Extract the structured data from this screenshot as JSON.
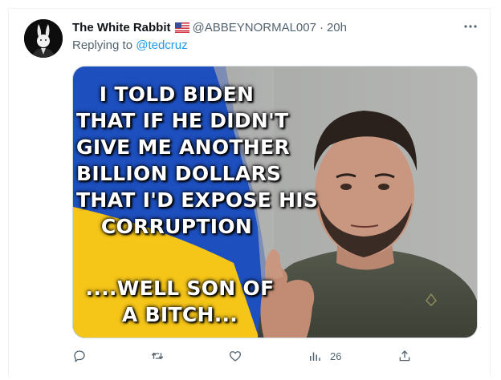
{
  "tweet": {
    "display_name": "The White Rabbit",
    "flag_icon": "us-flag-icon",
    "handle": "@ABBEYNORMAL007",
    "separator": "·",
    "time": "20h",
    "replying_prefix": "Replying to",
    "replying_to": "@tedcruz",
    "more_icon": "more-horizontal-icon"
  },
  "meme": {
    "top_lines": [
      "I TOLD BIDEN",
      "THAT IF HE DIDN'T",
      "GIVE ME ANOTHER",
      "BILLION DOLLARS",
      "THAT I'D EXPOSE HIS",
      "CORRUPTION"
    ],
    "bottom_lines": [
      "....WELL SON OF",
      "A BITCH..."
    ]
  },
  "actions": {
    "reply_icon": "reply-icon",
    "retweet_icon": "retweet-icon",
    "like_icon": "like-icon",
    "views_icon": "views-icon",
    "views_count": "26",
    "share_icon": "share-icon"
  },
  "colors": {
    "link": "#1d9bf0",
    "muted": "#536471",
    "flag_blue": "#1d4fbf",
    "flag_yellow": "#f5c518"
  }
}
